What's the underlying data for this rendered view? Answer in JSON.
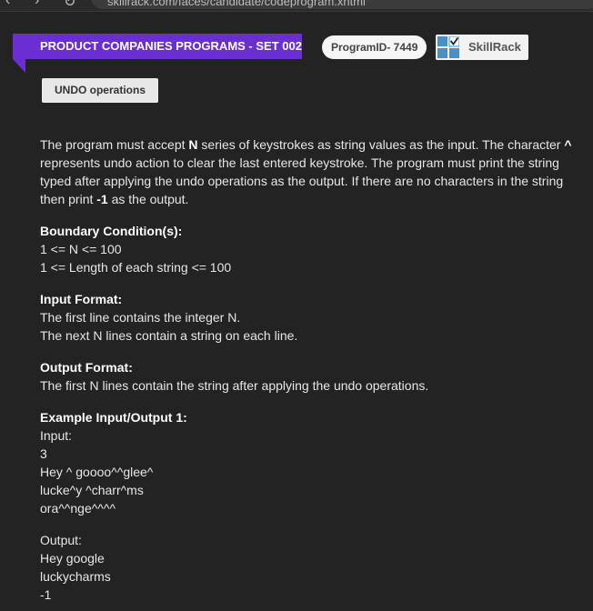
{
  "browser": {
    "url": "skillrack.com/faces/candidate/codeprogram.xhtml",
    "back_icon": "back-arrow-icon",
    "forward_icon": "forward-arrow-icon",
    "reload_icon": "reload-icon"
  },
  "header": {
    "ribbon_title": "PRODUCT COMPANIES PROGRAMS - SET 002",
    "program_id": "ProgramID- 7449",
    "brand_label": "SkillRack",
    "problem_title": "UNDO operations",
    "ribbon_color": "#6a2fd1"
  },
  "problem": {
    "desc_p1": "The program must accept ",
    "desc_b1": "N",
    "desc_p2": " series of keystrokes as string values as the input. The character ",
    "desc_b2": "^",
    "desc_p3": " represents undo action to clear the last entered keystroke. The program must print the string typed after applying the undo operations as the output. If there are no characters in the string then print ",
    "desc_b3": "-1",
    "desc_p4": " as the output.",
    "boundary_heading": "Boundary Condition(s):",
    "boundary_lines": [
      "1 <= N <= 100",
      "1 <= Length of each string <= 100"
    ],
    "input_heading": "Input Format:",
    "input_lines": [
      "The first line contains the integer N.",
      "The next N lines contain a string on each line."
    ],
    "output_heading": "Output Format:",
    "output_lines": [
      "The first N lines contain the string after applying the undo operations."
    ],
    "example_heading": "Example Input/Output 1:",
    "example_input_label": "Input:",
    "example_input_lines": [
      "3",
      "Hey ^ goooo^^glee^",
      "lucke^y ^charr^ms",
      "ora^^nge^^^^"
    ],
    "example_output_label": "Output:",
    "example_output_lines": [
      "Hey google",
      "luckycharms",
      "-1"
    ]
  }
}
